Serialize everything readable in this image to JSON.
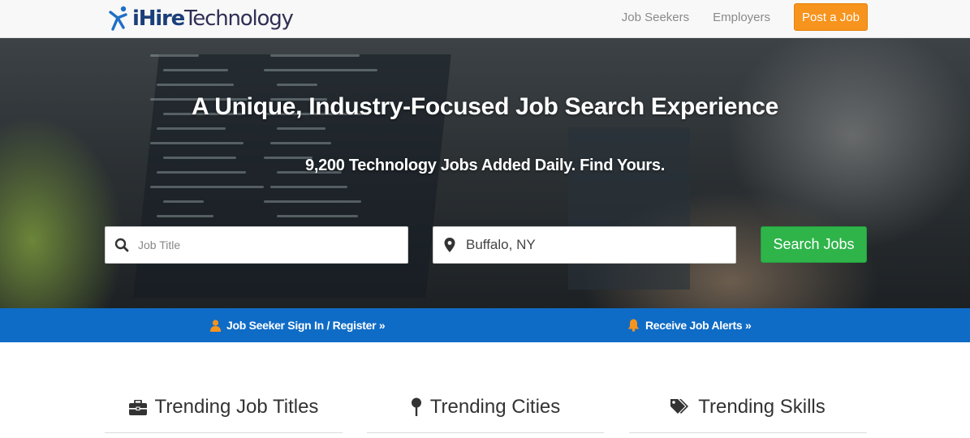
{
  "header": {
    "logo_bold": "iHire",
    "logo_rest": "Technology",
    "nav": [
      "Job Seekers",
      "Employers"
    ],
    "post_job_label": "Post a Job"
  },
  "hero": {
    "title": "A Unique, Industry-Focused Job Search Experience",
    "subtitle": "9,200 Technology Jobs Added Daily. Find Yours.",
    "job_title_placeholder": "Job Title",
    "location_value": "Buffalo, NY",
    "search_label": "Search Jobs"
  },
  "strip": {
    "signin_label": "Job Seeker Sign In / Register »",
    "alerts_label": "Receive Job Alerts »"
  },
  "trending": {
    "titles_label": "Trending Job Titles",
    "cities_label": "Trending Cities",
    "skills_label": "Trending Skills"
  },
  "colors": {
    "brand_blue": "#1b3f7a",
    "post_orange": "#f7941d",
    "search_green": "#2fb44a",
    "strip_blue": "#0f6cc6",
    "icon_orange": "#f7941d"
  },
  "icons": [
    "logo-mark-icon",
    "search-icon",
    "map-marker-icon",
    "user-icon",
    "bell-icon",
    "briefcase-icon",
    "map-pin-icon",
    "tags-icon"
  ]
}
